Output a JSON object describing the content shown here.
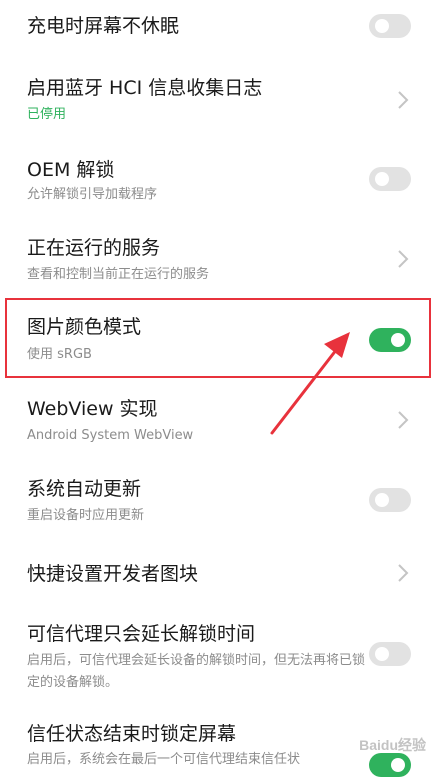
{
  "settings": {
    "items": [
      {
        "title": "充电时屏幕不休眠",
        "control": "toggle",
        "state": "off"
      },
      {
        "title": "启用蓝牙 HCI 信息收集日志",
        "subtitle": "已停用",
        "control": "chevron"
      },
      {
        "title": "OEM 解锁",
        "subtitle": "允许解锁引导加载程序",
        "control": "toggle",
        "state": "off"
      },
      {
        "title": "正在运行的服务",
        "subtitle": "查看和控制当前正在运行的服务",
        "control": "chevron"
      },
      {
        "title": "图片颜色模式",
        "subtitle": "使用 sRGB",
        "control": "toggle",
        "state": "on"
      },
      {
        "title": "WebView 实现",
        "subtitle": "Android System WebView",
        "control": "chevron"
      },
      {
        "title": "系统自动更新",
        "subtitle": "重启设备时应用更新",
        "control": "toggle",
        "state": "off"
      },
      {
        "title": "快捷设置开发者图块",
        "control": "chevron"
      },
      {
        "title": "可信代理只会延长解锁时间",
        "subtitle": "启用后，可信代理会延长设备的解锁时间，但无法再将已锁定的设备解锁。",
        "control": "toggle",
        "state": "off"
      },
      {
        "title": "信任状态结束时锁定屏幕",
        "subtitle": "启用后，系统会在最后一个可信代理结束信任状",
        "control": "toggle",
        "state": "on"
      }
    ]
  },
  "watermark": {
    "text": "Baidu经验"
  },
  "colors": {
    "accent": "#2fb25d",
    "highlight": "#e8323c"
  }
}
